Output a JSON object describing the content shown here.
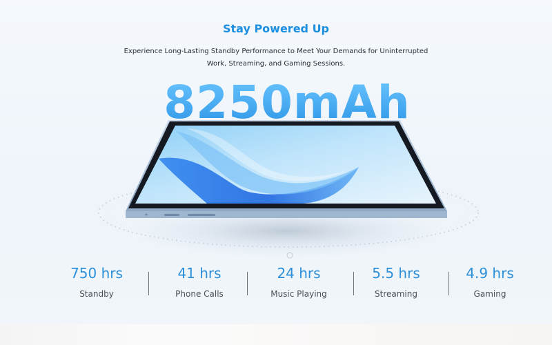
{
  "header": {
    "title": "Stay Powered Up",
    "subtitle": "Experience Long-Lasting Standby Performance to Meet Your Demands for Uninterrupted Work, Streaming, and Gaming Sessions."
  },
  "capacity": "8250mAh",
  "stats": [
    {
      "value": "750 hrs",
      "label": "Standby"
    },
    {
      "value": "41 hrs",
      "label": "Phone Calls"
    },
    {
      "value": "24 hrs",
      "label": "Music Playing"
    },
    {
      "value": "5.5 hrs",
      "label": "Streaming"
    },
    {
      "value": "4.9 hrs",
      "label": "Gaming"
    }
  ],
  "colors": {
    "accent": "#1d8fe0",
    "stat_value": "#2b8fd9",
    "capacity_top": "#6cc6ff",
    "capacity_bottom": "#2c95e6"
  }
}
